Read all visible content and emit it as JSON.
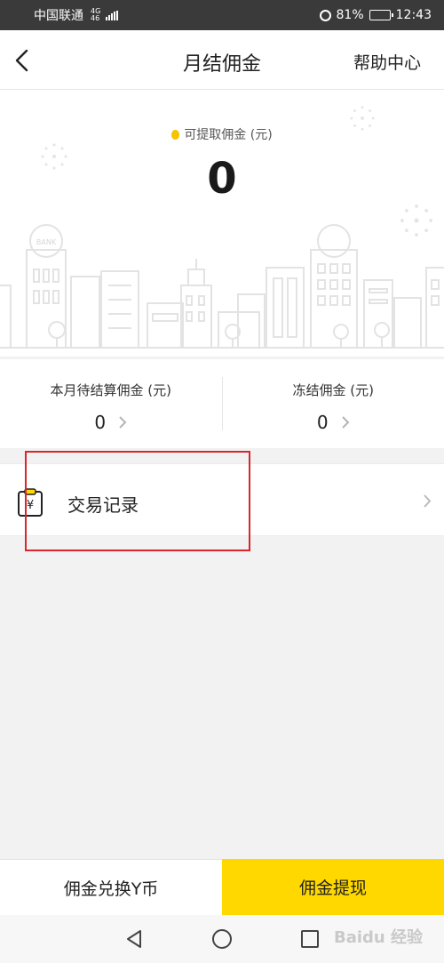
{
  "status_bar": {
    "carrier": "中国联通",
    "network_top": "4G",
    "network_bottom": "46",
    "battery_level": "81%",
    "battery_fraction": 0.81,
    "time": "12:43"
  },
  "header": {
    "title": "月结佣金",
    "help_link": "帮助中心"
  },
  "hero": {
    "label": "可提取佣金 (元)",
    "amount": "0",
    "bank_sign": "BANK"
  },
  "summary": {
    "pending_label": "本月待结算佣金 (元)",
    "pending_value": "0",
    "frozen_label": "冻结佣金 (元)",
    "frozen_value": "0"
  },
  "transactions": {
    "label": "交易记录",
    "icon_glyph": "¥"
  },
  "actions": {
    "exchange_label": "佣金兑换Y币",
    "withdraw_label": "佣金提现"
  },
  "watermark": "Baidu 经验",
  "colors": {
    "accent_yellow": "#ffd800",
    "highlight_red": "#d9262c",
    "status_bar": "#3a3a3a"
  }
}
